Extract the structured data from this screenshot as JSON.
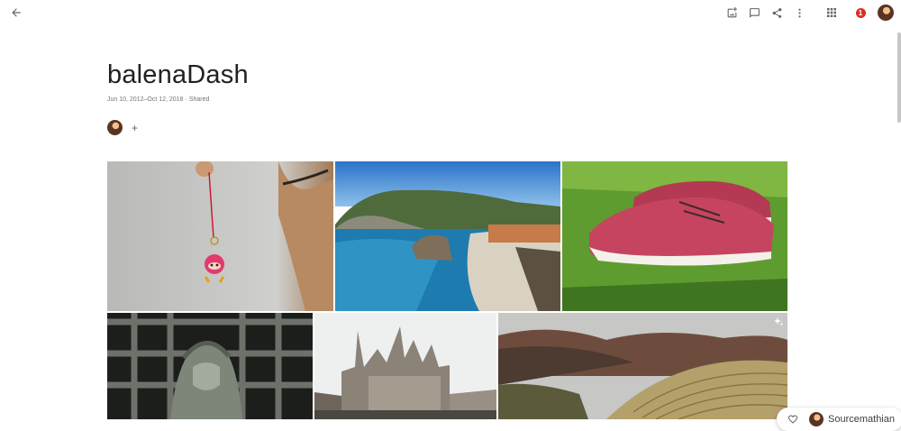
{
  "header": {
    "icons": [
      "arrow-back-icon",
      "add-photo-icon",
      "comment-icon",
      "share-icon",
      "more-vert-icon",
      "apps-grid-icon"
    ],
    "notification_count": "1"
  },
  "album": {
    "title": "balenaDash",
    "date_range": "Jun 10, 2012–Oct 12, 2018",
    "separator": "·",
    "visibility": "Shared",
    "add_person": "+"
  },
  "photos": [
    {
      "subject": "red charm on string"
    },
    {
      "subject": "coastal beach cliffs"
    },
    {
      "subject": "red sneakers on grass"
    },
    {
      "subject": "statue behind grate"
    },
    {
      "subject": "cathedral"
    },
    {
      "subject": "mountain terraces",
      "badge_icon": "sparkle-icon"
    }
  ],
  "activity": {
    "name": "Sourcemathian"
  },
  "colors": {
    "accent": "#1a73e8",
    "badge": "#d93025",
    "text_primary": "#202124",
    "text_secondary": "#70757a"
  }
}
